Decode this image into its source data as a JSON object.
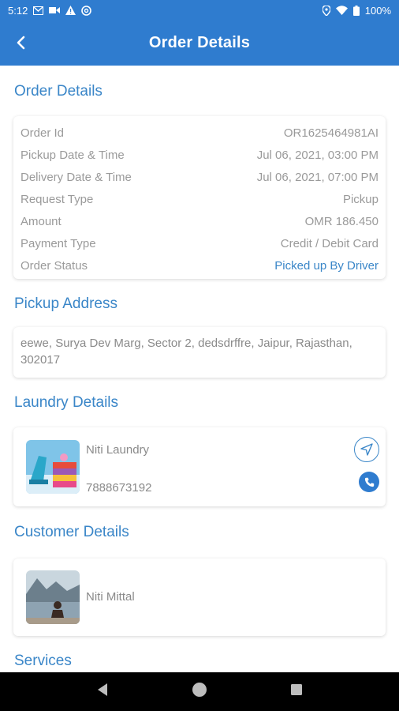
{
  "status_bar": {
    "time": "5:12",
    "battery": "100%",
    "left_icons": [
      "gmail-icon",
      "video-icon",
      "warning-icon",
      "at-icon"
    ],
    "right_icons": [
      "location-icon",
      "wifi-icon",
      "battery-icon"
    ]
  },
  "app_bar": {
    "title": "Order Details",
    "back_icon": "back-arrow-icon"
  },
  "order_details": {
    "section_title": "Order Details",
    "rows": [
      {
        "label": "Order Id",
        "value": "OR1625464981AI"
      },
      {
        "label": "Pickup Date & Time",
        "value": "Jul 06, 2021, 03:00 PM"
      },
      {
        "label": "Delivery Date & Time",
        "value": "Jul 06, 2021, 07:00 PM"
      },
      {
        "label": "Request Type",
        "value": "Pickup"
      },
      {
        "label": "Amount",
        "value": "OMR 186.450"
      },
      {
        "label": "Payment Type",
        "value": "Credit / Debit Card"
      },
      {
        "label": "Order Status",
        "value": "Picked up By Driver"
      }
    ]
  },
  "pickup_address": {
    "section_title": "Pickup Address",
    "text": "eewe, Surya Dev Marg, Sector 2, dedsdrffre, Jaipur, Rajasthan, 302017"
  },
  "laundry_details": {
    "section_title": "Laundry Details",
    "name": "Niti Laundry",
    "phone": "7888673192",
    "image": "laundry-photo",
    "actions": [
      "navigate-icon",
      "phone-icon"
    ]
  },
  "customer_details": {
    "section_title": "Customer Details",
    "name": "Niti Mittal",
    "image": "customer-photo"
  },
  "services": {
    "section_title": "Services"
  },
  "colors": {
    "primary": "#2f7ccf",
    "accent_text": "#3a86c8",
    "muted_text": "#9a9a9a"
  }
}
